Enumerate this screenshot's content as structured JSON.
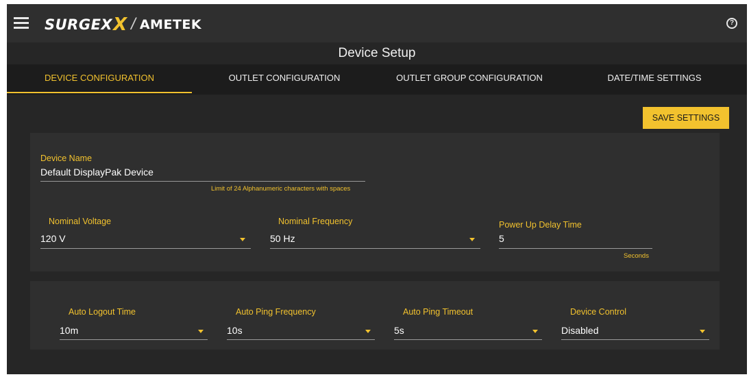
{
  "header": {
    "logo_surgex": "SURGEX",
    "logo_x": "X",
    "logo_slash": "/",
    "logo_ametek": "AMETEK",
    "help_icon": "?"
  },
  "page": {
    "title": "Device Setup"
  },
  "tabs": [
    {
      "label": "DEVICE CONFIGURATION",
      "active": true
    },
    {
      "label": "OUTLET CONFIGURATION",
      "active": false
    },
    {
      "label": "OUTLET GROUP CONFIGURATION",
      "active": false
    },
    {
      "label": "DATE/TIME SETTINGS",
      "active": false
    }
  ],
  "toolbar": {
    "save_label": "SAVE SETTINGS"
  },
  "device": {
    "name_label": "Device Name",
    "name_value": "Default DisplayPak Device",
    "name_hint": "Limit of 24 Alphanumeric characters with spaces",
    "voltage_label": "Nominal Voltage",
    "voltage_value": "120 V",
    "frequency_label": "Nominal Frequency",
    "frequency_value": "50 Hz",
    "delay_label": "Power Up Delay Time",
    "delay_value": "5",
    "delay_unit": "Seconds"
  },
  "session": {
    "logout_label": "Auto Logout Time",
    "logout_value": "10m",
    "ping_freq_label": "Auto Ping Frequency",
    "ping_freq_value": "10s",
    "ping_timeout_label": "Auto Ping Timeout",
    "ping_timeout_value": "5s",
    "control_label": "Device Control",
    "control_value": "Disabled"
  },
  "colors": {
    "accent": "#f2c22e",
    "background": "#262626",
    "card": "#2f2f2f",
    "tabbar": "#1c1c1c"
  },
  "icons": {
    "menu": "hamburger-menu-icon",
    "help": "help-circle-icon",
    "dropdown": "caret-down-icon"
  }
}
